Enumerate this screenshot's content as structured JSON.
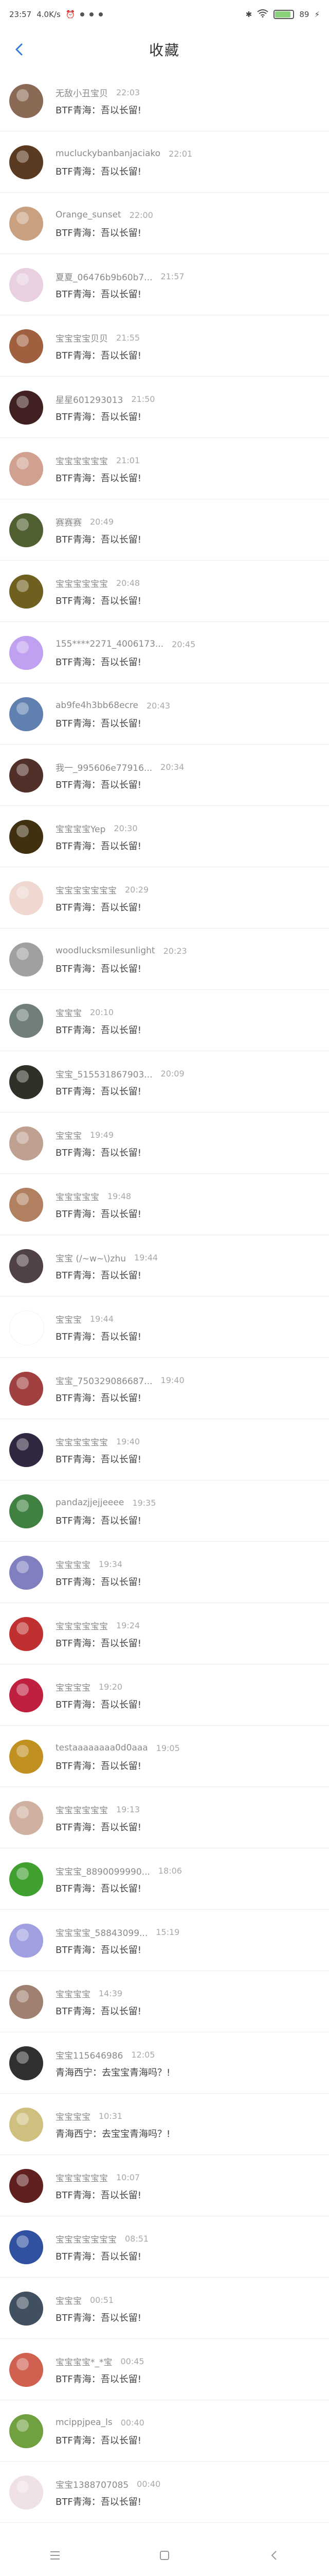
{
  "status_bar": {
    "time": "23:57",
    "net_speed": "4.0K/s",
    "battery": "89",
    "battery_level": 0.89,
    "icons": [
      "alarm-icon",
      "notification-dot-icon",
      "bluetooth-icon",
      "wifi-icon",
      "battery-icon",
      "charging-icon"
    ]
  },
  "header": {
    "title": "收藏",
    "back_icon": "back-arrow-icon"
  },
  "colors": {
    "accent": "#2e7dd1",
    "meta": "#a8a8a8",
    "divider": "#eeeeee"
  },
  "items": [
    {
      "user": "无敌小丑宝贝",
      "time": "22:03",
      "message": "BTF青海：吾以长留!"
    },
    {
      "user": "mucluckybanbanjaciako",
      "time": "22:01",
      "message": "BTF青海：吾以长留!"
    },
    {
      "user": "Orange_sunset",
      "time": "22:00",
      "message": "BTF青海：吾以长留!"
    },
    {
      "user": "夏夏_06476b9b60b7...",
      "time": "21:57",
      "message": "BTF青海：吾以长留!"
    },
    {
      "user": "宝宝宝宝贝贝",
      "time": "21:55",
      "message": "BTF青海：吾以长留!"
    },
    {
      "user": "星星601293013",
      "time": "21:50",
      "message": "BTF青海：吾以长留!"
    },
    {
      "user": "宝宝宝宝宝宝",
      "time": "21:01",
      "message": "BTF青海：吾以长留!"
    },
    {
      "user": "赛赛赛",
      "time": "20:49",
      "message": "BTF青海：吾以长留!"
    },
    {
      "user": "宝宝宝宝宝宝",
      "time": "20:48",
      "message": "BTF青海：吾以长留!"
    },
    {
      "user": "155****2271_4006173...",
      "time": "20:45",
      "message": "BTF青海：吾以长留!"
    },
    {
      "user": "ab9fe4h3bb68ecre",
      "time": "20:43",
      "message": "BTF青海：吾以长留!"
    },
    {
      "user": "我一_995606e77916...",
      "time": "20:34",
      "message": "BTF青海：吾以长留!"
    },
    {
      "user": "宝宝宝宝Yep",
      "time": "20:30",
      "message": "BTF青海：吾以长留!"
    },
    {
      "user": "宝宝宝宝宝宝宝",
      "time": "20:29",
      "message": "BTF青海：吾以长留!"
    },
    {
      "user": "woodlucksmilesunlight",
      "time": "20:23",
      "message": "BTF青海：吾以长留!"
    },
    {
      "user": "宝宝宝",
      "time": "20:10",
      "message": "BTF青海：吾以长留!"
    },
    {
      "user": "宝宝_515531867903...",
      "time": "20:09",
      "message": "BTF青海：吾以长留!"
    },
    {
      "user": "宝宝宝",
      "time": "19:49",
      "message": "BTF青海：吾以长留!"
    },
    {
      "user": "宝宝宝宝宝",
      "time": "19:48",
      "message": "BTF青海：吾以长留!"
    },
    {
      "user": "宝宝 (/~w~\\)zhu",
      "time": "19:44",
      "message": "BTF青海：吾以长留!"
    },
    {
      "user": "宝宝宝",
      "time": "19:44",
      "message": "BTF青海：吾以长留!"
    },
    {
      "user": "宝宝_750329086687...",
      "time": "19:40",
      "message": "BTF青海：吾以长留!"
    },
    {
      "user": "宝宝宝宝宝宝",
      "time": "19:40",
      "message": "BTF青海：吾以长留!"
    },
    {
      "user": "pandazjjejjeeee",
      "time": "19:35",
      "message": "BTF青海：吾以长留!"
    },
    {
      "user": "宝宝宝宝",
      "time": "19:34",
      "message": "BTF青海：吾以长留!"
    },
    {
      "user": "宝宝宝宝宝宝",
      "time": "19:24",
      "message": "BTF青海：吾以长留!"
    },
    {
      "user": "宝宝宝宝",
      "time": "19:20",
      "message": "BTF青海：吾以长留!"
    },
    {
      "user": "testaaaaaaaa0d0aaa",
      "time": "19:05",
      "message": "BTF青海：吾以长留!"
    },
    {
      "user": "宝宝宝宝宝宝",
      "time": "19:13",
      "message": "BTF青海：吾以长留!"
    },
    {
      "user": "宝宝宝_8890099990...",
      "time": "18:06",
      "message": "BTF青海：吾以长留!"
    },
    {
      "user": "宝宝宝宝_58843099...",
      "time": "15:19",
      "message": "BTF青海：吾以长留!"
    },
    {
      "user": "宝宝宝宝",
      "time": "14:39",
      "message": "BTF青海：吾以长留!"
    },
    {
      "user": "宝宝115646986",
      "time": "12:05",
      "message": "青海西宁：去宝宝青海吗？!"
    },
    {
      "user": "宝宝宝宝",
      "time": "10:31",
      "message": "青海西宁：去宝宝青海吗？!"
    },
    {
      "user": "宝宝宝宝宝宝",
      "time": "10:07",
      "message": "BTF青海：吾以长留!"
    },
    {
      "user": "宝宝宝宝宝宝宝",
      "time": "08:51",
      "message": "BTF青海：吾以长留!"
    },
    {
      "user": "宝宝宝",
      "time": "00:51",
      "message": "BTF青海：吾以长留!"
    },
    {
      "user": "宝宝宝宝*_*宝",
      "time": "00:45",
      "message": "BTF青海：吾以长留!"
    },
    {
      "user": "mcippjpea_ls",
      "time": "00:40",
      "message": "BTF青海：吾以长留!"
    },
    {
      "user": "宝宝1388707085",
      "time": "00:40",
      "message": "BTF青海：吾以长留!"
    }
  ],
  "avatar_colors": [
    "#8a6a55",
    "#5a3a20",
    "#c9a080",
    "#e8d0e0",
    "#a06040",
    "#402020",
    "#d0a090",
    "#506030",
    "#706020",
    "#c0a0f0",
    "#6080b0",
    "#503028",
    "#403010",
    "#f0d8d0",
    "#a0a0a0",
    "#708078",
    "#303028",
    "#c0a090",
    "#b08060",
    "#504048",
    "#ffffff",
    "#a04040",
    "#302840",
    "#408040",
    "#8080c0",
    "#c03030",
    "#c02040",
    "#c09020",
    "#d0b0a0",
    "#40a030",
    "#a0a0e0",
    "#a08070",
    "#303030",
    "#d0c080",
    "#602020",
    "#3050a0",
    "#405060",
    "#d06050",
    "#70a040",
    "#f0e0e8"
  ],
  "nav": {
    "menu_icon": "menu-icon",
    "home_icon": "home-square-icon",
    "back_icon": "nav-back-icon"
  }
}
